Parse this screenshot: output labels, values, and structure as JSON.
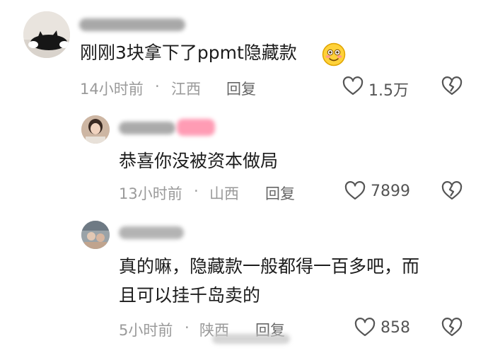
{
  "comments": [
    {
      "text": "刚刚3块拿下了ppmt隐藏款",
      "time": "14小时前",
      "location": "江西",
      "reply_label": "回复",
      "likes": "1.5万"
    },
    {
      "text": "恭喜你没被资本做局",
      "time": "13小时前",
      "location": "山西",
      "reply_label": "回复",
      "likes": "7899"
    },
    {
      "text_line1": "真的嘛，隐藏款一般都得一百多吧，而",
      "text_line2": "且可以挂千岛卖的",
      "time": "5小时前",
      "location": "陕西",
      "reply_label": "回复",
      "likes": "858"
    }
  ],
  "separator": "·",
  "icons": {
    "like": "heart-outline-icon",
    "dislike": "broken-heart-icon",
    "emoji": "smiling-face-emoji-icon"
  },
  "colors": {
    "meta": "#9a9a9a",
    "text": "#1c1c1c",
    "icon": "#555555"
  }
}
